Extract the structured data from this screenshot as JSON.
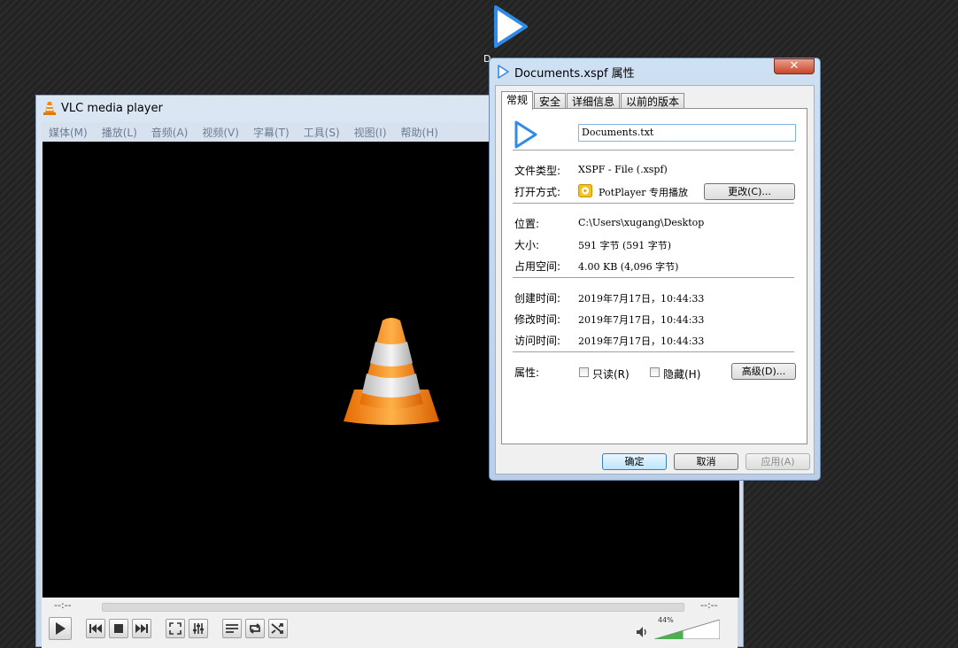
{
  "desktop": {
    "icon_label": "D"
  },
  "vlc": {
    "title": "VLC media player",
    "menu": [
      "媒体(M)",
      "播放(L)",
      "音频(A)",
      "视频(V)",
      "字幕(T)",
      "工具(S)",
      "视图(I)",
      "帮助(H)"
    ],
    "time_elapsed": "--:--",
    "time_total": "--:--",
    "volume_label": "44%",
    "volume_level": 0.44
  },
  "dialog": {
    "title": "Documents.xspf 属性",
    "close_glyph": "✕",
    "tabs": [
      "常规",
      "安全",
      "详细信息",
      "以前的版本"
    ],
    "filename": "Documents.txt",
    "file_type_label": "文件类型:",
    "file_type_value": "XSPF - File (.xspf)",
    "open_with_label": "打开方式:",
    "open_with_value": "PotPlayer 专用播放",
    "change_button": "更改(C)...",
    "location_label": "位置:",
    "location_value": "C:\\Users\\xugang\\Desktop",
    "size_label": "大小:",
    "size_value": "591 字节 (591 字节)",
    "disk_size_label": "占用空间:",
    "disk_size_value": "4.00 KB (4,096 字节)",
    "created_label": "创建时间:",
    "created_value": "2019年7月17日，10:44:33",
    "modified_label": "修改时间:",
    "modified_value": "2019年7月17日，10:44:33",
    "accessed_label": "访问时间:",
    "accessed_value": "2019年7月17日，10:44:33",
    "attributes_label": "属性:",
    "readonly_label": "只读(R)",
    "hidden_label": "隐藏(H)",
    "advanced_button": "高级(D)...",
    "ok_button": "确定",
    "cancel_button": "取消",
    "apply_button": "应用(A)"
  },
  "colors": {
    "accent": "#3a8ee6",
    "video_bg": "#000000",
    "cone_orange": "#f28a17"
  }
}
